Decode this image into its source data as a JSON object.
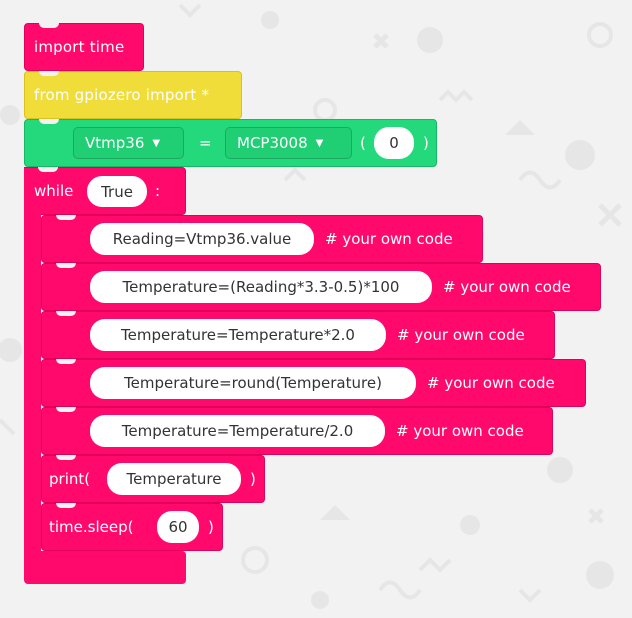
{
  "blocks": {
    "import_time": "import time",
    "from_gpiozero": "from gpiozero import *",
    "assign": {
      "variable": "Vtmp36",
      "equals": "=",
      "function": "MCP3008",
      "open_paren": "(",
      "channel": "0",
      "close_paren": ")"
    },
    "while": {
      "keyword": "while",
      "condition": "True",
      "colon": ":"
    },
    "body": [
      {
        "code": "Reading=Vtmp36.value",
        "comment": "# your own code"
      },
      {
        "code": "Temperature=(Reading*3.3-0.5)*100",
        "comment": "# your own code"
      },
      {
        "code": "Temperature=Temperature*2.0",
        "comment": "# your own code"
      },
      {
        "code": "Temperature=round(Temperature)",
        "comment": "# your own code"
      },
      {
        "code": "Temperature=Temperature/2.0",
        "comment": "# your own code"
      }
    ],
    "print": {
      "label": "print(",
      "arg": "Temperature",
      "close": ")"
    },
    "sleep": {
      "label": "time.sleep(",
      "arg": "60",
      "close": ")"
    }
  },
  "colors": {
    "pink": "#ff0a6c",
    "yellow": "#f1dd3a",
    "green": "#24d97c",
    "background": "#f2f2f2"
  },
  "icons": [
    "caret-down-icon"
  ]
}
